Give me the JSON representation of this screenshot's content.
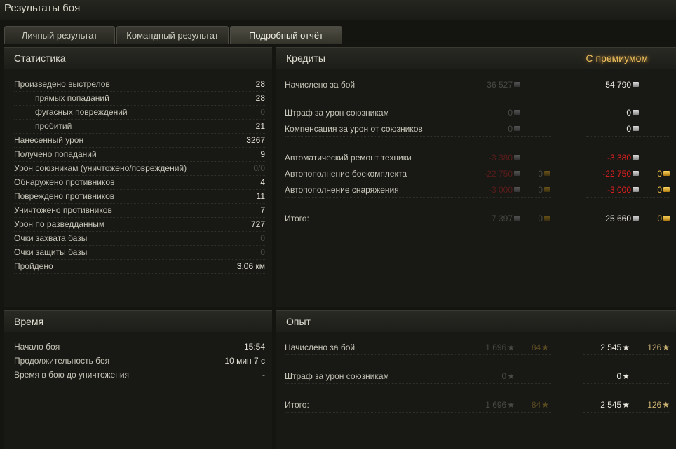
{
  "window": {
    "title": "Результаты боя"
  },
  "tabs": [
    "Личный результат",
    "Командный результат",
    "Подробный отчёт"
  ],
  "stats": {
    "title": "Статистика",
    "rows": [
      {
        "label": "Произведено выстрелов",
        "value": "28"
      },
      {
        "label": "прямых попаданий",
        "value": "28"
      },
      {
        "label": "фугасных повреждений",
        "value": "0"
      },
      {
        "label": "пробитий",
        "value": "21"
      },
      {
        "label": "Нанесенный урон",
        "value": "3267"
      },
      {
        "label": "Получено попаданий",
        "value": "9"
      },
      {
        "label": "Урон союзникам (уничтожено/повреждений)",
        "value": "0/0"
      },
      {
        "label": "Обнаружено противников",
        "value": "4"
      },
      {
        "label": "Повреждено противников",
        "value": "11"
      },
      {
        "label": "Уничтожено противников",
        "value": "7"
      },
      {
        "label": "Урон по разведданным",
        "value": "727"
      },
      {
        "label": "Очки захвата базы",
        "value": "0"
      },
      {
        "label": "Очки защиты базы",
        "value": "0"
      },
      {
        "label": "Пройдено",
        "value": "3,06 км"
      }
    ]
  },
  "credits": {
    "title": "Кредиты",
    "premium_label": "С премиумом",
    "rows": [
      {
        "label": "Начислено за бой",
        "base_credits": "36 527",
        "base_gold": "",
        "prem_credits": "54 790",
        "prem_gold": ""
      },
      {
        "label": "Штраф за урон союзникам",
        "base_credits": "0",
        "base_gold": "",
        "prem_credits": "0",
        "prem_gold": ""
      },
      {
        "label": "Компенсация за урон от союзников",
        "base_credits": "0",
        "base_gold": "",
        "prem_credits": "0",
        "prem_gold": ""
      },
      {
        "label": "Автоматический ремонт техники",
        "base_credits": "-3 380",
        "base_gold": "",
        "prem_credits": "-3 380",
        "prem_gold": ""
      },
      {
        "label": "Автопополнение боекомплекта",
        "base_credits": "-22 750",
        "base_gold": "0",
        "prem_credits": "-22 750",
        "prem_gold": "0"
      },
      {
        "label": "Автопополнение снаряжения",
        "base_credits": "-3 000",
        "base_gold": "0",
        "prem_credits": "-3 000",
        "prem_gold": "0"
      },
      {
        "label": "Итого:",
        "base_credits": "7 397",
        "base_gold": "0",
        "prem_credits": "25 660",
        "prem_gold": "0"
      }
    ]
  },
  "time": {
    "title": "Время",
    "rows": [
      {
        "label": "Начало боя",
        "value": "15:54"
      },
      {
        "label": "Продолжительность боя",
        "value": "10 мин 7 с"
      },
      {
        "label": "Время в бою до уничтожения",
        "value": "-"
      }
    ]
  },
  "experience": {
    "title": "Опыт",
    "rows": [
      {
        "label": "Начислено за бой",
        "base_xp": "1 696",
        "base_free": "84",
        "prem_xp": "2 545",
        "prem_free": "126"
      },
      {
        "label": "Штраф за урон союзникам",
        "base_xp": "0",
        "base_free": "",
        "prem_xp": "0",
        "prem_free": ""
      },
      {
        "label": "Итого:",
        "base_xp": "1 696",
        "base_free": "84",
        "prem_xp": "2 545",
        "prem_free": "126"
      }
    ]
  },
  "icons": {
    "credit": "silver-coin-icon",
    "gold": "gold-coin-icon",
    "xp": "star-icon"
  },
  "colors": {
    "premium": "#f2c460",
    "negative": "#e02020",
    "gold": "#f0c040"
  }
}
